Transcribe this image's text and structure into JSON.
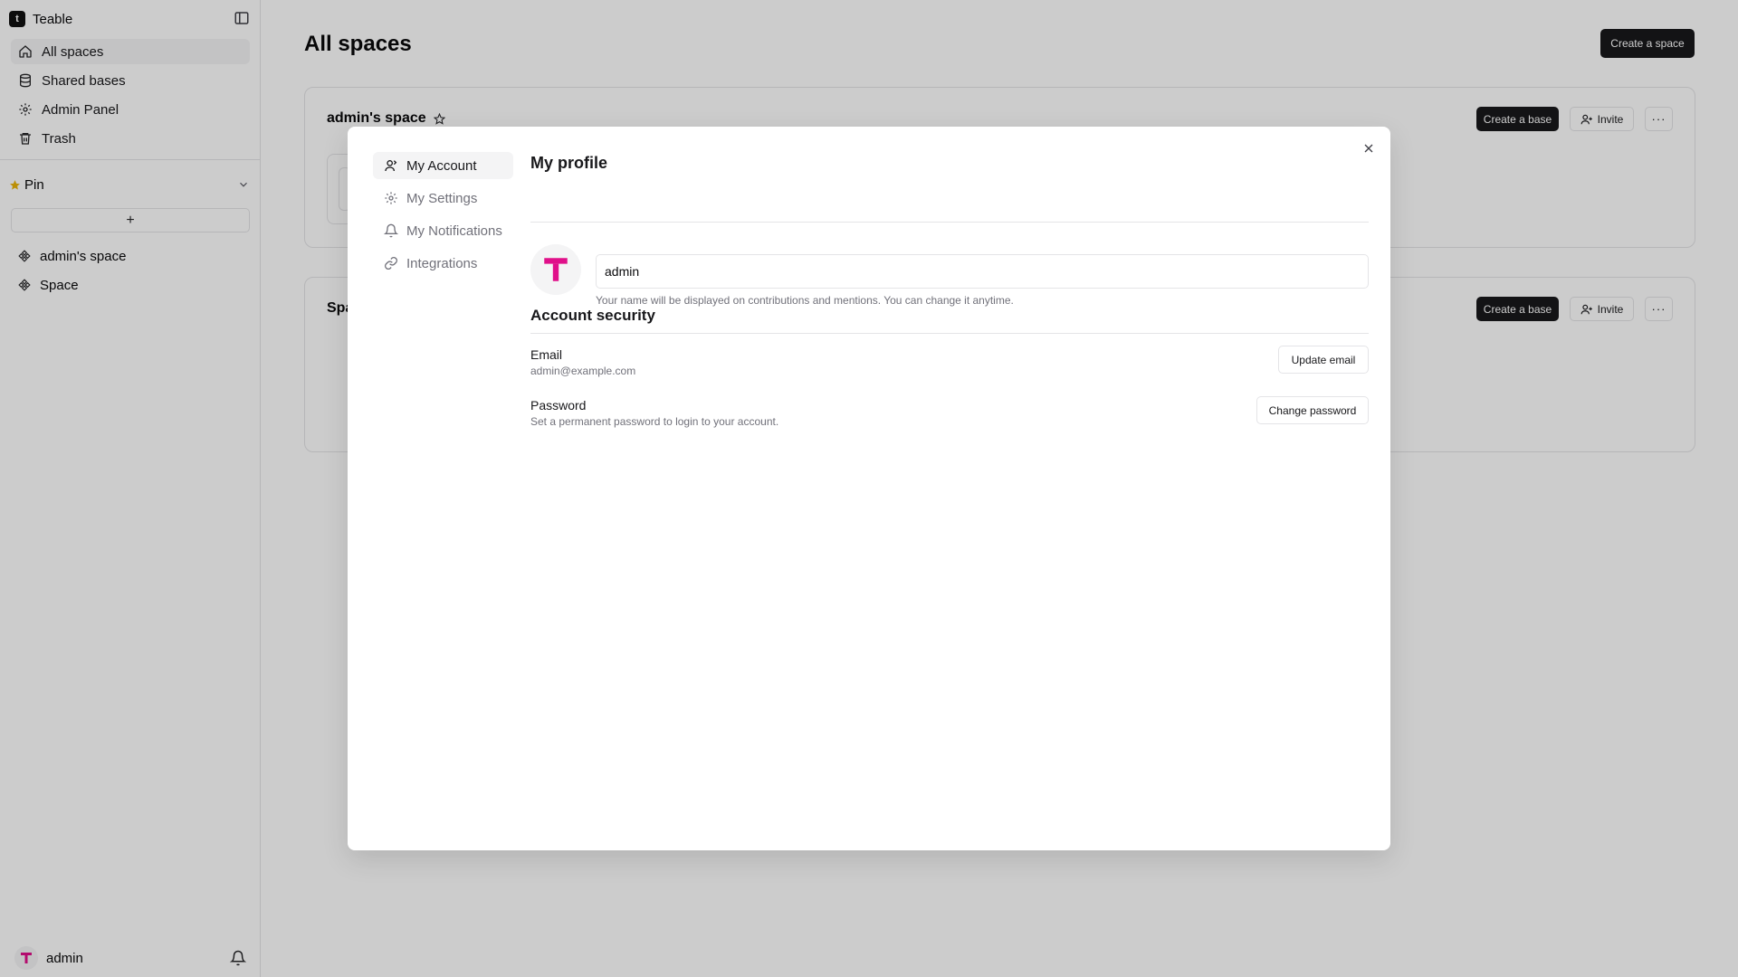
{
  "app": {
    "name": "Teable"
  },
  "sidebar": {
    "nav": [
      {
        "label": "All spaces",
        "icon": "home-icon",
        "active": true
      },
      {
        "label": "Shared bases",
        "icon": "database-icon"
      },
      {
        "label": "Admin Panel",
        "icon": "gear-icon"
      },
      {
        "label": "Trash",
        "icon": "trash-icon"
      }
    ],
    "pin_label": "Pin",
    "add_button": "+",
    "spaces": [
      {
        "label": "admin's space"
      },
      {
        "label": "Space"
      }
    ],
    "user": {
      "name": "admin"
    }
  },
  "main": {
    "title": "All spaces",
    "create_space": "Create a space",
    "cards": [
      {
        "title": "admin's space",
        "create_base": "Create a base",
        "invite": "Invite",
        "more": "···"
      },
      {
        "title": "Space",
        "create_base": "Create a base",
        "invite": "Invite",
        "more": "···"
      }
    ]
  },
  "modal": {
    "nav": [
      {
        "label": "My Account",
        "icon": "user-icon",
        "active": true
      },
      {
        "label": "My Settings",
        "icon": "gear-icon"
      },
      {
        "label": "My Notifications",
        "icon": "bell-icon"
      },
      {
        "label": "Integrations",
        "icon": "link-icon"
      }
    ],
    "profile_title": "My profile",
    "name_value": "admin",
    "name_hint": "Your name will be displayed on contributions and mentions. You can change it anytime.",
    "security_title": "Account security",
    "email_label": "Email",
    "email_value": "admin@example.com",
    "update_email": "Update email",
    "password_label": "Password",
    "password_desc": "Set a permanent password to login to your account.",
    "change_password": "Change password"
  },
  "colors": {
    "brand_pink": "#e0108a",
    "dark_button": "#18181b",
    "pin_star": "#eab308"
  }
}
